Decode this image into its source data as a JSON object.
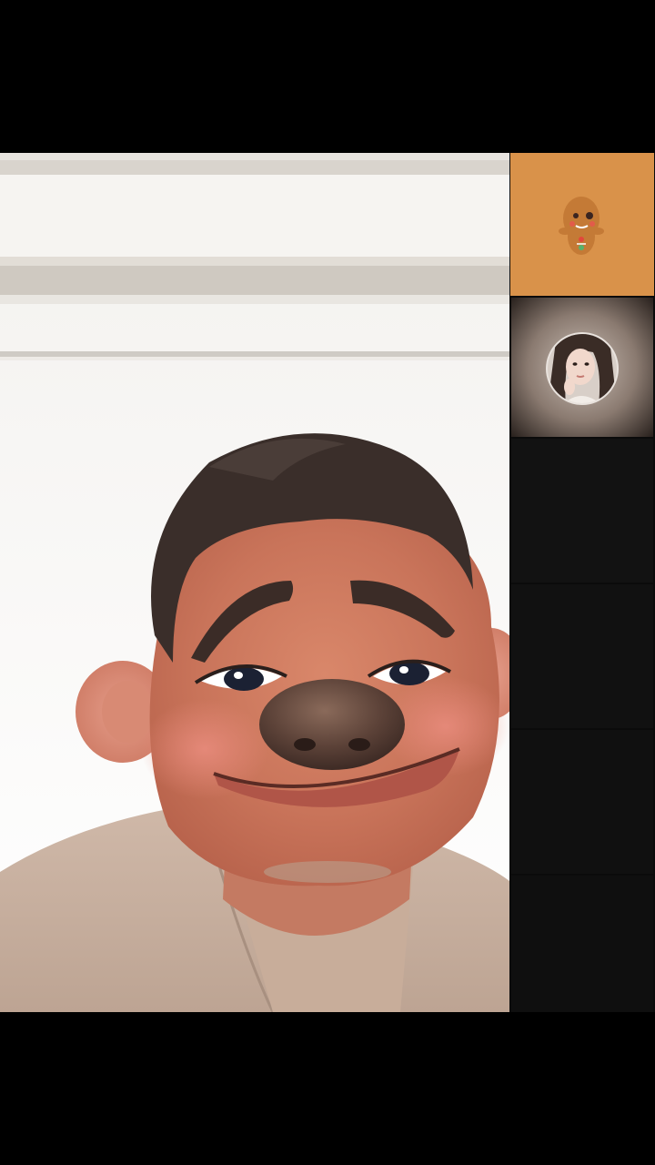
{
  "call": {
    "main_participant": {
      "icon": "cartoon-face-filter-video",
      "filter": "cartoon face"
    },
    "participants": [
      {
        "icon": "gingerbread-avatar",
        "background": "#d9924a"
      },
      {
        "icon": "user-photo-avatar"
      },
      {
        "icon": "empty-slot"
      },
      {
        "icon": "empty-slot"
      },
      {
        "icon": "empty-slot"
      },
      {
        "icon": "empty-slot"
      }
    ]
  },
  "colors": {
    "letterbox": "#000000",
    "tile_orange": "#d9924a",
    "empty_tile": "#111111"
  }
}
